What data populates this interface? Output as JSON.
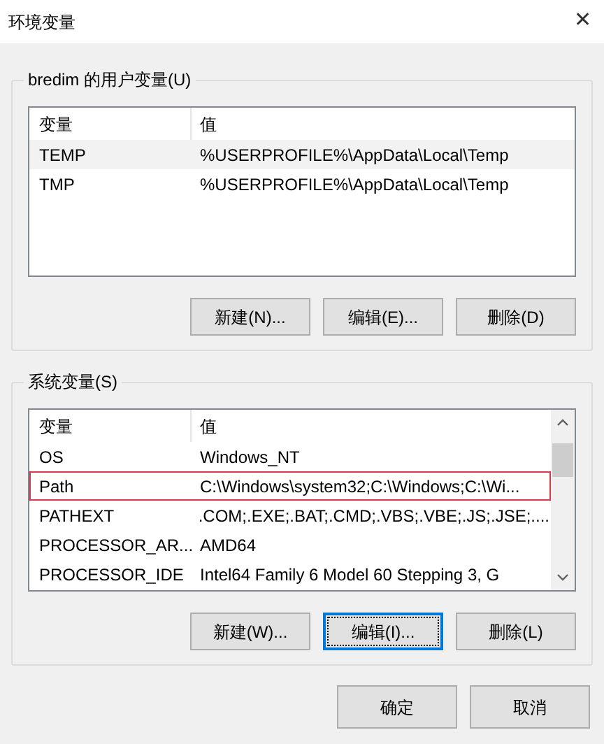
{
  "window": {
    "title": "环境变量",
    "close": "✕"
  },
  "groups": [
    {
      "legend": "bredim 的用户变量(U)",
      "columns": [
        "变量",
        "值"
      ],
      "scrollbar": false,
      "rows": [
        {
          "name": "TEMP",
          "value": "%USERPROFILE%\\AppData\\Local\\Temp",
          "selected": false,
          "hovered": true
        },
        {
          "name": "TMP",
          "value": "%USERPROFILE%\\AppData\\Local\\Temp",
          "selected": false,
          "hovered": false
        }
      ],
      "buttons": [
        {
          "label": "新建(N)...",
          "focused": false
        },
        {
          "label": "编辑(E)...",
          "focused": false
        },
        {
          "label": "删除(D)",
          "focused": false
        }
      ]
    },
    {
      "legend": "系统变量(S)",
      "columns": [
        "变量",
        "值"
      ],
      "scrollbar": true,
      "rows": [
        {
          "name": "OS",
          "value": "Windows_NT",
          "selected": false,
          "hovered": false
        },
        {
          "name": "Path",
          "value": "C:\\Windows\\system32;C:\\Windows;C:\\Wi...",
          "selected": true,
          "hovered": false
        },
        {
          "name": "PATHEXT",
          "value": ".COM;.EXE;.BAT;.CMD;.VBS;.VBE;.JS;.JSE;....",
          "selected": false,
          "hovered": false
        },
        {
          "name": "PROCESSOR_AR...",
          "value": "AMD64",
          "selected": false,
          "hovered": false
        },
        {
          "name": "PROCESSOR_IDE",
          "value": "Intel64 Family 6 Model 60 Stepping 3, G",
          "selected": false,
          "hovered": false
        }
      ],
      "buttons": [
        {
          "label": "新建(W)...",
          "focused": false
        },
        {
          "label": "编辑(I)...",
          "focused": true
        },
        {
          "label": "删除(L)",
          "focused": false
        }
      ]
    }
  ],
  "footer_buttons": [
    "确定",
    "取消"
  ]
}
